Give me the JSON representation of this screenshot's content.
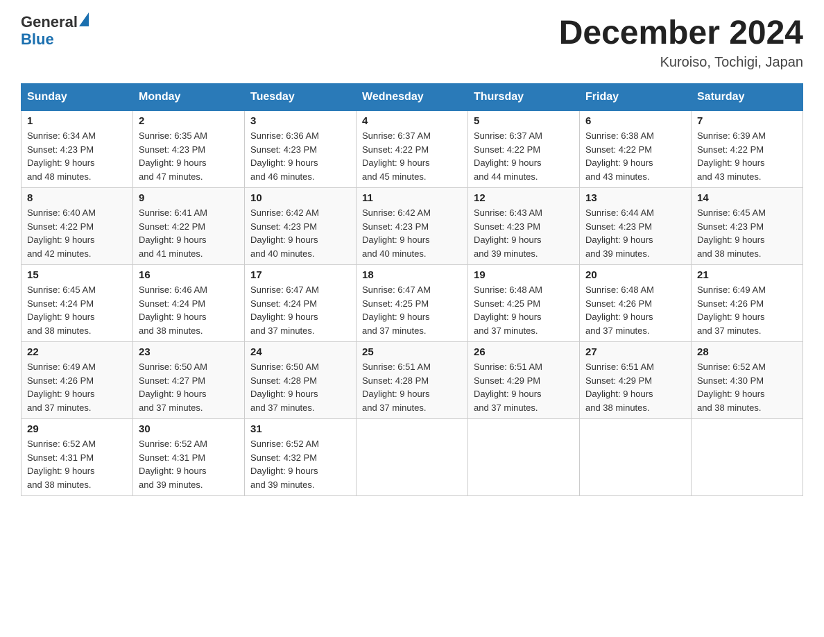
{
  "header": {
    "logo_text1": "General",
    "logo_text2": "Blue",
    "main_title": "December 2024",
    "subtitle": "Kuroiso, Tochigi, Japan"
  },
  "days_of_week": [
    "Sunday",
    "Monday",
    "Tuesday",
    "Wednesday",
    "Thursday",
    "Friday",
    "Saturday"
  ],
  "weeks": [
    [
      {
        "day": "1",
        "sunrise": "6:34 AM",
        "sunset": "4:23 PM",
        "daylight": "9 hours and 48 minutes."
      },
      {
        "day": "2",
        "sunrise": "6:35 AM",
        "sunset": "4:23 PM",
        "daylight": "9 hours and 47 minutes."
      },
      {
        "day": "3",
        "sunrise": "6:36 AM",
        "sunset": "4:23 PM",
        "daylight": "9 hours and 46 minutes."
      },
      {
        "day": "4",
        "sunrise": "6:37 AM",
        "sunset": "4:22 PM",
        "daylight": "9 hours and 45 minutes."
      },
      {
        "day": "5",
        "sunrise": "6:37 AM",
        "sunset": "4:22 PM",
        "daylight": "9 hours and 44 minutes."
      },
      {
        "day": "6",
        "sunrise": "6:38 AM",
        "sunset": "4:22 PM",
        "daylight": "9 hours and 43 minutes."
      },
      {
        "day": "7",
        "sunrise": "6:39 AM",
        "sunset": "4:22 PM",
        "daylight": "9 hours and 43 minutes."
      }
    ],
    [
      {
        "day": "8",
        "sunrise": "6:40 AM",
        "sunset": "4:22 PM",
        "daylight": "9 hours and 42 minutes."
      },
      {
        "day": "9",
        "sunrise": "6:41 AM",
        "sunset": "4:22 PM",
        "daylight": "9 hours and 41 minutes."
      },
      {
        "day": "10",
        "sunrise": "6:42 AM",
        "sunset": "4:23 PM",
        "daylight": "9 hours and 40 minutes."
      },
      {
        "day": "11",
        "sunrise": "6:42 AM",
        "sunset": "4:23 PM",
        "daylight": "9 hours and 40 minutes."
      },
      {
        "day": "12",
        "sunrise": "6:43 AM",
        "sunset": "4:23 PM",
        "daylight": "9 hours and 39 minutes."
      },
      {
        "day": "13",
        "sunrise": "6:44 AM",
        "sunset": "4:23 PM",
        "daylight": "9 hours and 39 minutes."
      },
      {
        "day": "14",
        "sunrise": "6:45 AM",
        "sunset": "4:23 PM",
        "daylight": "9 hours and 38 minutes."
      }
    ],
    [
      {
        "day": "15",
        "sunrise": "6:45 AM",
        "sunset": "4:24 PM",
        "daylight": "9 hours and 38 minutes."
      },
      {
        "day": "16",
        "sunrise": "6:46 AM",
        "sunset": "4:24 PM",
        "daylight": "9 hours and 38 minutes."
      },
      {
        "day": "17",
        "sunrise": "6:47 AM",
        "sunset": "4:24 PM",
        "daylight": "9 hours and 37 minutes."
      },
      {
        "day": "18",
        "sunrise": "6:47 AM",
        "sunset": "4:25 PM",
        "daylight": "9 hours and 37 minutes."
      },
      {
        "day": "19",
        "sunrise": "6:48 AM",
        "sunset": "4:25 PM",
        "daylight": "9 hours and 37 minutes."
      },
      {
        "day": "20",
        "sunrise": "6:48 AM",
        "sunset": "4:26 PM",
        "daylight": "9 hours and 37 minutes."
      },
      {
        "day": "21",
        "sunrise": "6:49 AM",
        "sunset": "4:26 PM",
        "daylight": "9 hours and 37 minutes."
      }
    ],
    [
      {
        "day": "22",
        "sunrise": "6:49 AM",
        "sunset": "4:26 PM",
        "daylight": "9 hours and 37 minutes."
      },
      {
        "day": "23",
        "sunrise": "6:50 AM",
        "sunset": "4:27 PM",
        "daylight": "9 hours and 37 minutes."
      },
      {
        "day": "24",
        "sunrise": "6:50 AM",
        "sunset": "4:28 PM",
        "daylight": "9 hours and 37 minutes."
      },
      {
        "day": "25",
        "sunrise": "6:51 AM",
        "sunset": "4:28 PM",
        "daylight": "9 hours and 37 minutes."
      },
      {
        "day": "26",
        "sunrise": "6:51 AM",
        "sunset": "4:29 PM",
        "daylight": "9 hours and 37 minutes."
      },
      {
        "day": "27",
        "sunrise": "6:51 AM",
        "sunset": "4:29 PM",
        "daylight": "9 hours and 38 minutes."
      },
      {
        "day": "28",
        "sunrise": "6:52 AM",
        "sunset": "4:30 PM",
        "daylight": "9 hours and 38 minutes."
      }
    ],
    [
      {
        "day": "29",
        "sunrise": "6:52 AM",
        "sunset": "4:31 PM",
        "daylight": "9 hours and 38 minutes."
      },
      {
        "day": "30",
        "sunrise": "6:52 AM",
        "sunset": "4:31 PM",
        "daylight": "9 hours and 39 minutes."
      },
      {
        "day": "31",
        "sunrise": "6:52 AM",
        "sunset": "4:32 PM",
        "daylight": "9 hours and 39 minutes."
      },
      null,
      null,
      null,
      null
    ]
  ],
  "labels": {
    "sunrise": "Sunrise:",
    "sunset": "Sunset:",
    "daylight": "Daylight:"
  }
}
